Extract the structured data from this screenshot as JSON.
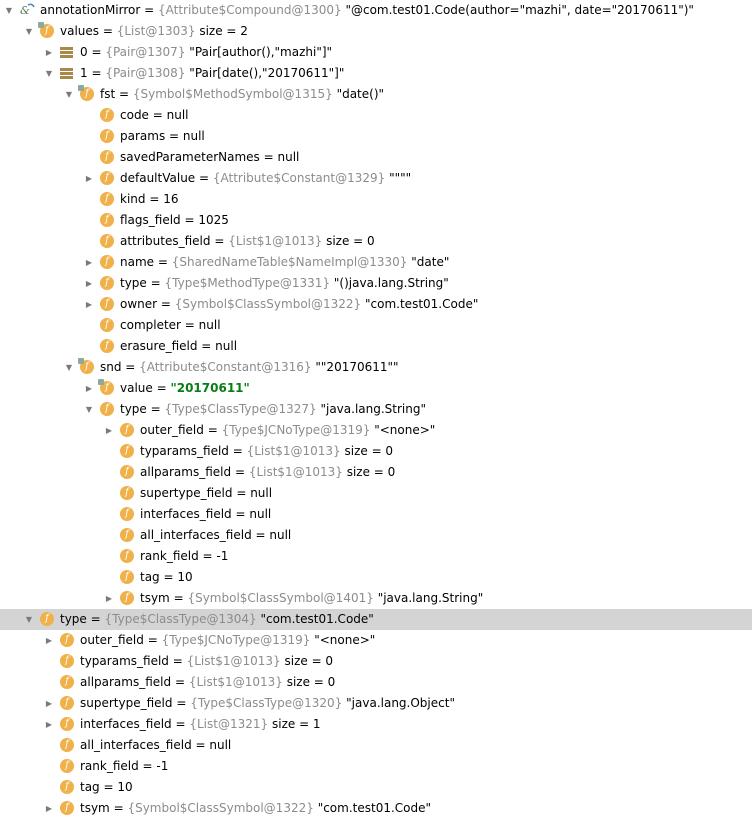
{
  "window": {
    "title": "Debugger variables tree"
  },
  "rows": [
    {
      "id": 0,
      "expanded": "open",
      "icon": "annotation-icon",
      "name": "annotationMirror",
      "type_ref": "{Attribute$Compound@1300}",
      "value": "\"@com.test01.Code(author=\"mazhi\", date=\"20170611\")\""
    },
    {
      "id": 1,
      "expanded": "open",
      "icon": "field-final-icon",
      "name": "values",
      "type_ref": "{List@1303}",
      "value": " size = 2"
    },
    {
      "id": 2,
      "expanded": "closed",
      "icon": "list-icon",
      "name": "0",
      "type_ref": "{Pair@1307}",
      "value": "\"Pair[author(),\"mazhi\"]\""
    },
    {
      "id": 3,
      "expanded": "open",
      "icon": "list-icon",
      "name": "1",
      "type_ref": "{Pair@1308}",
      "value": "\"Pair[date(),\"20170611\"]\""
    },
    {
      "id": 4,
      "expanded": "open",
      "icon": "field-final-icon",
      "name": "fst",
      "type_ref": "{Symbol$MethodSymbol@1315}",
      "value": "\"date()\""
    },
    {
      "id": 5,
      "expanded": "none",
      "icon": "field-icon",
      "name": "code",
      "type_ref": "",
      "value": "null"
    },
    {
      "id": 6,
      "expanded": "none",
      "icon": "field-icon",
      "name": "params",
      "type_ref": "",
      "value": "null"
    },
    {
      "id": 7,
      "expanded": "none",
      "icon": "field-icon",
      "name": "savedParameterNames",
      "type_ref": "",
      "value": "null"
    },
    {
      "id": 8,
      "expanded": "closed",
      "icon": "field-icon",
      "name": "defaultValue",
      "type_ref": "{Attribute$Constant@1329}",
      "value": "\"\"\"\""
    },
    {
      "id": 9,
      "expanded": "none",
      "icon": "field-icon",
      "name": "kind",
      "type_ref": "",
      "value": "16"
    },
    {
      "id": 10,
      "expanded": "none",
      "icon": "field-icon",
      "name": "flags_field",
      "type_ref": "",
      "value": "1025"
    },
    {
      "id": 11,
      "expanded": "none",
      "icon": "field-icon",
      "name": "attributes_field",
      "type_ref": "{List$1@1013}",
      "value": " size = 0"
    },
    {
      "id": 12,
      "expanded": "closed",
      "icon": "field-icon",
      "name": "name",
      "type_ref": "{SharedNameTable$NameImpl@1330}",
      "value": "\"date\""
    },
    {
      "id": 13,
      "expanded": "closed",
      "icon": "field-icon",
      "name": "type",
      "type_ref": "{Type$MethodType@1331}",
      "value": "\"()java.lang.String\""
    },
    {
      "id": 14,
      "expanded": "closed",
      "icon": "field-icon",
      "name": "owner",
      "type_ref": "{Symbol$ClassSymbol@1322}",
      "value": "\"com.test01.Code\""
    },
    {
      "id": 15,
      "expanded": "none",
      "icon": "field-icon",
      "name": "completer",
      "type_ref": "",
      "value": "null"
    },
    {
      "id": 16,
      "expanded": "none",
      "icon": "field-icon",
      "name": "erasure_field",
      "type_ref": "",
      "value": "null"
    },
    {
      "id": 17,
      "expanded": "open",
      "icon": "field-final-icon",
      "name": "snd",
      "type_ref": "{Attribute$Constant@1316}",
      "value": "\"\"20170611\"\""
    },
    {
      "id": 18,
      "expanded": "closed",
      "icon": "field-final-icon",
      "name": "value",
      "type_ref": "",
      "value": "\"20170611\""
    },
    {
      "id": 19,
      "expanded": "open",
      "icon": "field-icon",
      "name": "type",
      "type_ref": "{Type$ClassType@1327}",
      "value": "\"java.lang.String\""
    },
    {
      "id": 20,
      "expanded": "closed",
      "icon": "field-icon",
      "name": "outer_field",
      "type_ref": "{Type$JCNoType@1319}",
      "value": "\"<none>\""
    },
    {
      "id": 21,
      "expanded": "none",
      "icon": "field-icon",
      "name": "typarams_field",
      "type_ref": "{List$1@1013}",
      "value": " size = 0"
    },
    {
      "id": 22,
      "expanded": "none",
      "icon": "field-icon",
      "name": "allparams_field",
      "type_ref": "{List$1@1013}",
      "value": " size = 0"
    },
    {
      "id": 23,
      "expanded": "none",
      "icon": "field-icon",
      "name": "supertype_field",
      "type_ref": "",
      "value": "null"
    },
    {
      "id": 24,
      "expanded": "none",
      "icon": "field-icon",
      "name": "interfaces_field",
      "type_ref": "",
      "value": "null"
    },
    {
      "id": 25,
      "expanded": "none",
      "icon": "field-icon",
      "name": "all_interfaces_field",
      "type_ref": "",
      "value": "null"
    },
    {
      "id": 26,
      "expanded": "none",
      "icon": "field-icon",
      "name": "rank_field",
      "type_ref": "",
      "value": "-1"
    },
    {
      "id": 27,
      "expanded": "none",
      "icon": "field-icon",
      "name": "tag",
      "type_ref": "",
      "value": "10"
    },
    {
      "id": 28,
      "expanded": "closed",
      "icon": "field-icon",
      "name": "tsym",
      "type_ref": "{Symbol$ClassSymbol@1401}",
      "value": "\"java.lang.String\""
    },
    {
      "id": 29,
      "expanded": "open",
      "icon": "field-icon",
      "name": "type",
      "type_ref": "{Type$ClassType@1304}",
      "value": "\"com.test01.Code\"",
      "selected": true
    },
    {
      "id": 30,
      "expanded": "closed",
      "icon": "field-icon",
      "name": "outer_field",
      "type_ref": "{Type$JCNoType@1319}",
      "value": "\"<none>\""
    },
    {
      "id": 31,
      "expanded": "none",
      "icon": "field-icon",
      "name": "typarams_field",
      "type_ref": "{List$1@1013}",
      "value": " size = 0"
    },
    {
      "id": 32,
      "expanded": "none",
      "icon": "field-icon",
      "name": "allparams_field",
      "type_ref": "{List$1@1013}",
      "value": " size = 0"
    },
    {
      "id": 33,
      "expanded": "closed",
      "icon": "field-icon",
      "name": "supertype_field",
      "type_ref": "{Type$ClassType@1320}",
      "value": "\"java.lang.Object\""
    },
    {
      "id": 34,
      "expanded": "closed",
      "icon": "field-icon",
      "name": "interfaces_field",
      "type_ref": "{List@1321}",
      "value": " size = 1"
    },
    {
      "id": 35,
      "expanded": "none",
      "icon": "field-icon",
      "name": "all_interfaces_field",
      "type_ref": "",
      "value": "null"
    },
    {
      "id": 36,
      "expanded": "none",
      "icon": "field-icon",
      "name": "rank_field",
      "type_ref": "",
      "value": "-1"
    },
    {
      "id": 37,
      "expanded": "none",
      "icon": "field-icon",
      "name": "tag",
      "type_ref": "",
      "value": "10"
    },
    {
      "id": 38,
      "expanded": "closed",
      "icon": "field-icon",
      "name": "tsym",
      "type_ref": "{Symbol$ClassSymbol@1322}",
      "value": "\"com.test01.Code\""
    }
  ],
  "colors": {
    "field_icon": "#f0b04a",
    "type_ref": "#8c8c8c",
    "string_value": "#067d17",
    "selection": "#d4d4d4"
  }
}
